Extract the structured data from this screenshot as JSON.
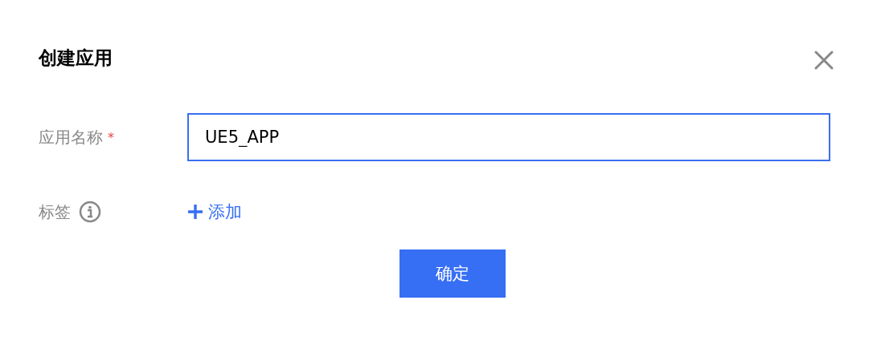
{
  "dialog": {
    "title": "创建应用"
  },
  "fields": [
    {
      "kind": "input",
      "label": "应用名称",
      "required_mark": "*",
      "value": "UE5_APP",
      "focused": true
    },
    {
      "kind": "tags",
      "label": "标签",
      "info": true,
      "add_label": "添加"
    }
  ],
  "buttons": [
    {
      "label": "确定",
      "primary": true
    }
  ]
}
